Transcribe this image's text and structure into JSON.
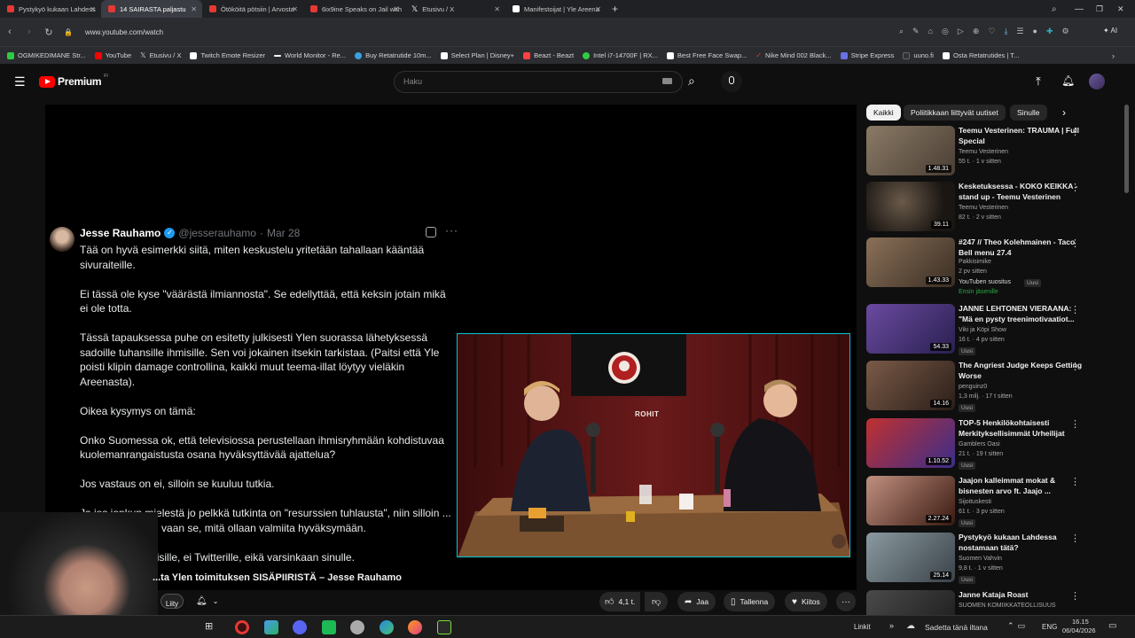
{
  "browser": {
    "tabs": [
      {
        "label": "Pystykyö kukaan Lahdess",
        "color": "#e53935"
      },
      {
        "label": "14 SAIRASTA paljastu",
        "color": "#e53935"
      },
      {
        "label": "Ötököitä pötsiin | Arvosta",
        "color": "#e53935"
      },
      {
        "label": "6ix9ine Speaks on Jail with",
        "color": "#e53935"
      },
      {
        "label": "Etusivu / X",
        "color": "#ffffff"
      },
      {
        "label": "Manifestoijat | Yle Areena",
        "color": "#ffffff"
      }
    ],
    "url": "www.youtube.com/watch",
    "bookmarks": [
      {
        "label": "OGMIKEDIMANE Str...",
        "color": "#2ecc40"
      },
      {
        "label": "YouTube",
        "color": "#ff0000"
      },
      {
        "label": "Etusivu / X",
        "color": "#ffffff"
      },
      {
        "label": "Twitch Emote Resizer",
        "color": "#ffffff"
      },
      {
        "label": "World Monitor - Re...",
        "color": "#ffffff"
      },
      {
        "label": "Buy Retatrutide 10m...",
        "color": "#3aa0e0"
      },
      {
        "label": "Select Plan | Disney+",
        "color": "#ffffff"
      },
      {
        "label": "Beazt - Beazt",
        "color": "#ff4040"
      },
      {
        "label": "Intel i7-14700F | RX...",
        "color": "#2ecc40"
      },
      {
        "label": "Best Free Face Swap...",
        "color": "#ffffff"
      },
      {
        "label": "Nike Mind 002 Black...",
        "color": "#e53935"
      },
      {
        "label": "Stripe Express",
        "color": "#6772e5"
      },
      {
        "label": "uuno.fi",
        "color": "#333333"
      },
      {
        "label": "Osta Retatrutides | T...",
        "color": "#ffffff"
      }
    ]
  },
  "header": {
    "logo_label": "Premium",
    "logo_suffix": "FI",
    "search_placeholder": "Haku"
  },
  "tweet": {
    "name": "Jesse Rauhamo",
    "handle": "@jesserauhamo",
    "date": "Mar 28",
    "paragraphs": [
      "Tää on hyvä esimerkki siitä, miten keskustelu yritetään tahallaan kääntää sivuraiteille.",
      "Ei tässä ole kyse \"väärästä ilmiannosta\". Se edellyttää, että keksin jotain mikä ei ole totta.",
      "Tässä tapauksessa puhe on esitetty julkisesti Ylen suorassa lähetyksessä sadoille tuhansille ihmisille. Sen voi jokainen itsekin tarkistaa. (Paitsi että Yle poisti klipin damage controllina, kaikki muut teema-illat löytyy vieläkin Areenasta).",
      "Oikea kysymys on tämä:",
      "Onko Suomessa ok, että televisiossa perustellaan ihmisryhmään kohdistuvaa kuolemanrangaistusta osana hyväksyttävää ajattelua?",
      "Jos vastaus on ei, silloin se kuuluu tutkia.",
      "Ja jos jonkun mielestä jo pelkkä tutkinta on \"resurssien tuhlausta\", niin silloin ... ole rikosilmoitus, vaan se, mitä ollaan valmiita hyväksymään.",
      "... nti kuuluu poliisille, ei Twitterille, eikä varsinkaan sinulle."
    ]
  },
  "video": {
    "title": "...ta Ylen toimituksen SISÄPIIRISTÄ – Jesse Rauhamo",
    "sign_text": "ROHIT",
    "join_label": "Liity",
    "actions": {
      "likes": "4,1 t.",
      "share": "Jaa",
      "save": "Tallenna",
      "thanks": "Kiitos"
    }
  },
  "sidebar": {
    "chips": [
      "Kaikki",
      "Poliitikkaan liittyvät uutiset",
      "Sinulle"
    ],
    "recommendations": [
      {
        "title": "Teemu Vesterinen: TRAUMA | Full Special",
        "channel": "Teemu Vesterinen",
        "meta": "55 t. · 1 v sitten",
        "duration": "1.48.31",
        "bg": "#6a6055",
        "badge": "",
        "extra": ""
      },
      {
        "title": "Kesketuksessa - KOKO KEIKKA - stand up - Teemu Vesterinen",
        "channel": "Teemu Vesterinen",
        "meta": "82 t. · 2 v sitten",
        "duration": "39.11",
        "bg": "#2a2420",
        "badge": "",
        "extra": ""
      },
      {
        "title": "#247 // Theo Kolehmainen - Taco Bell menu 27.4",
        "channel": "Pakkisimike",
        "meta": "2 pv sitten",
        "duration": "1.43.33",
        "bg": "#6b5a48",
        "badge": "Uusi",
        "extra": "YouTuben suositus",
        "member": "Ensin jäsenille"
      },
      {
        "title": "JANNE LEHTONEN VIERAANA: \"Mä en pysty treenimotivaatiot...",
        "channel": "Viki ja Köpi Show",
        "meta": "16 t. · 4 pv sitten",
        "duration": "54.33",
        "bg": "#4a3e6a",
        "badge": "Uusi",
        "extra": ""
      },
      {
        "title": "The Angriest Judge Keeps Getting Worse",
        "channel": "penguinz0",
        "meta": "1,3 milj. · 17 t sitten",
        "duration": "14.16",
        "bg": "#5a4a40",
        "badge": "Uusi",
        "extra": ""
      },
      {
        "title": "TOP-5 Henkilökohtaisesti Merkityksellisimmät Urheilijat",
        "channel": "Gamblers Oasi",
        "meta": "21 t. · 19 t sitten",
        "duration": "1.10.52",
        "bg": "#3a2e6a",
        "badge": "Uusi",
        "extra": ""
      },
      {
        "title": "Jaajon kalleimmat mokat & bisnesten arvo ft. Jaajo ...",
        "channel": "Sijoituskesti",
        "meta": "61 t. · 3 pv sitten",
        "duration": "2.27.24",
        "bg": "#5a3020",
        "badge": "Uusi",
        "extra": ""
      },
      {
        "title": "Pystykyö kukaan Lahdessa nostamaan tätä?",
        "channel": "Suomen Vahvin",
        "meta": "9,8 t. · 1 v sitten",
        "duration": "25.14",
        "bg": "#505a60",
        "badge": "Uusi",
        "extra": ""
      },
      {
        "title": "Janne Kataja Roast",
        "channel": "SUOMEN KOMIIKKATEOLLISUUS",
        "meta": "",
        "duration": "",
        "bg": "#3a3a3a",
        "badge": "",
        "extra": ""
      }
    ]
  },
  "taskbar": {
    "links": "Linkit",
    "weather": "Sadetta tänä iltana",
    "lang": "ENG",
    "time": "16.15",
    "date": "06/04/2026"
  }
}
